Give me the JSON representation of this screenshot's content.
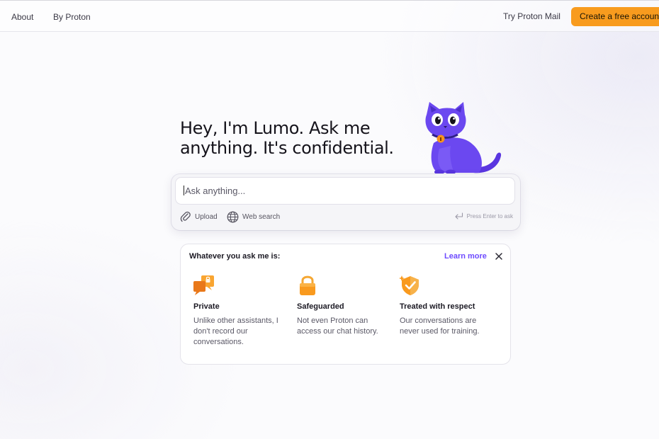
{
  "nav": {
    "about": "About",
    "by_proton": "By Proton",
    "try_mail": "Try Proton Mail",
    "cta": "Create a free account"
  },
  "hero": {
    "line1": "Hey, I'm Lumo. Ask me",
    "line2": "anything. It's confidential."
  },
  "composer": {
    "placeholder": "Ask anything...",
    "upload_label": "Upload",
    "web_search_label": "Web search",
    "enter_hint": "Press Enter to ask"
  },
  "info": {
    "heading": "Whatever you ask me is:",
    "learn_more": "Learn more",
    "features": [
      {
        "icon": "speech-bubbles-lock-icon",
        "title": "Private",
        "desc": "Unlike other assistants, I don't record our conversations."
      },
      {
        "icon": "padlock-icon",
        "title": "Safeguarded",
        "desc": "Not even Proton can access our chat history."
      },
      {
        "icon": "shield-check-icon",
        "title": "Treated with respect",
        "desc": "Our conversations are never used for training."
      }
    ]
  },
  "colors": {
    "accent_orange": "#f89b1e",
    "brand_purple": "#6d4aff",
    "mascot_purple": "#6b48f0"
  }
}
